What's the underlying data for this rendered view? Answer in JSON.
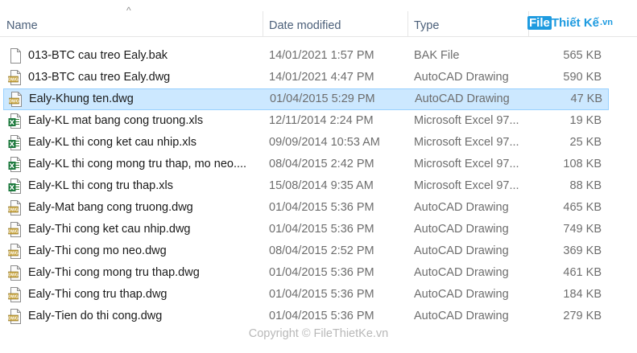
{
  "header": {
    "name": "Name",
    "date": "Date modified",
    "type": "Type",
    "size": ""
  },
  "watermark": {
    "part1": "File",
    "part2": "Thiết Kế",
    "part3": ".vn"
  },
  "files": [
    {
      "name": "013-BTC cau treo Ealy.bak",
      "date": "14/01/2021 1:57 PM",
      "type": "BAK File",
      "size": "565 KB",
      "icon": "blank-file-icon",
      "selected": false
    },
    {
      "name": "013-BTC cau treo Ealy.dwg",
      "date": "14/01/2021 4:47 PM",
      "type": "AutoCAD Drawing",
      "size": "590 KB",
      "icon": "dwg-file-icon",
      "selected": false
    },
    {
      "name": "Ealy-Khung ten.dwg",
      "date": "01/04/2015 5:29 PM",
      "type": "AutoCAD Drawing",
      "size": "47 KB",
      "icon": "dwg-file-icon",
      "selected": true
    },
    {
      "name": "Ealy-KL mat bang cong truong.xls",
      "date": "12/11/2014 2:24 PM",
      "type": "Microsoft Excel 97...",
      "size": "19 KB",
      "icon": "excel-file-icon",
      "selected": false
    },
    {
      "name": "Ealy-KL thi cong ket cau nhip.xls",
      "date": "09/09/2014 10:53 AM",
      "type": "Microsoft Excel 97...",
      "size": "25 KB",
      "icon": "excel-file-icon",
      "selected": false
    },
    {
      "name": "Ealy-KL thi cong mong tru thap, mo neo....",
      "date": "08/04/2015 2:42 PM",
      "type": "Microsoft Excel 97...",
      "size": "108 KB",
      "icon": "excel-file-icon",
      "selected": false
    },
    {
      "name": "Ealy-KL thi cong tru thap.xls",
      "date": "15/08/2014 9:35 AM",
      "type": "Microsoft Excel 97...",
      "size": "88 KB",
      "icon": "excel-file-icon",
      "selected": false
    },
    {
      "name": "Ealy-Mat bang cong truong.dwg",
      "date": "01/04/2015 5:36 PM",
      "type": "AutoCAD Drawing",
      "size": "465 KB",
      "icon": "dwg-file-icon",
      "selected": false
    },
    {
      "name": "Ealy-Thi cong ket cau nhip.dwg",
      "date": "01/04/2015 5:36 PM",
      "type": "AutoCAD Drawing",
      "size": "749 KB",
      "icon": "dwg-file-icon",
      "selected": false
    },
    {
      "name": "Ealy-Thi cong mo neo.dwg",
      "date": "08/04/2015 2:52 PM",
      "type": "AutoCAD Drawing",
      "size": "369 KB",
      "icon": "dwg-file-icon",
      "selected": false
    },
    {
      "name": "Ealy-Thi cong mong tru thap.dwg",
      "date": "01/04/2015 5:36 PM",
      "type": "AutoCAD Drawing",
      "size": "461 KB",
      "icon": "dwg-file-icon",
      "selected": false
    },
    {
      "name": "Ealy-Thi cong tru thap.dwg",
      "date": "01/04/2015 5:36 PM",
      "type": "AutoCAD Drawing",
      "size": "184 KB",
      "icon": "dwg-file-icon",
      "selected": false
    },
    {
      "name": "Ealy-Tien do thi cong.dwg",
      "date": "01/04/2015 5:36 PM",
      "type": "AutoCAD Drawing",
      "size": "279 KB",
      "icon": "dwg-file-icon",
      "selected": false
    }
  ],
  "copyright": "Copyright © FileThietKe.vn",
  "colors": {
    "header_text": "#4c607a",
    "selected_bg": "#cce8ff",
    "selected_border": "#99d1ff",
    "secondary_text": "#6d6d6d"
  }
}
